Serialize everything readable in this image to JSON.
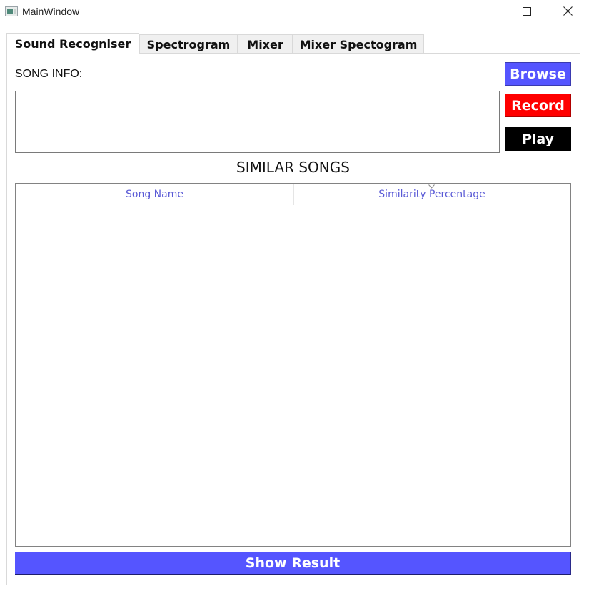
{
  "window": {
    "title": "MainWindow",
    "controls": [
      "minimize",
      "maximize",
      "close"
    ]
  },
  "tabs": [
    {
      "label": "Sound Recogniser",
      "active": true
    },
    {
      "label": "Spectrogram",
      "active": false
    },
    {
      "label": "Mixer",
      "active": false
    },
    {
      "label": "Mixer Spectogram",
      "active": false
    }
  ],
  "recogniser": {
    "song_info_label": "SONG INFO:",
    "song_info_value": "",
    "buttons": {
      "browse": "Browse",
      "record": "Record",
      "play": "Play"
    },
    "button_colors": {
      "browse": "#5555ff",
      "record": "#ff0000",
      "play": "#000000"
    },
    "similar_songs_title": "SIMILAR SONGS",
    "table": {
      "columns": [
        "Song Name",
        "Similarity Percentage"
      ],
      "sorted_column": "Similarity Percentage",
      "rows": []
    },
    "show_result_label": "Show Result",
    "header_text_color": "#5a5ad6"
  }
}
